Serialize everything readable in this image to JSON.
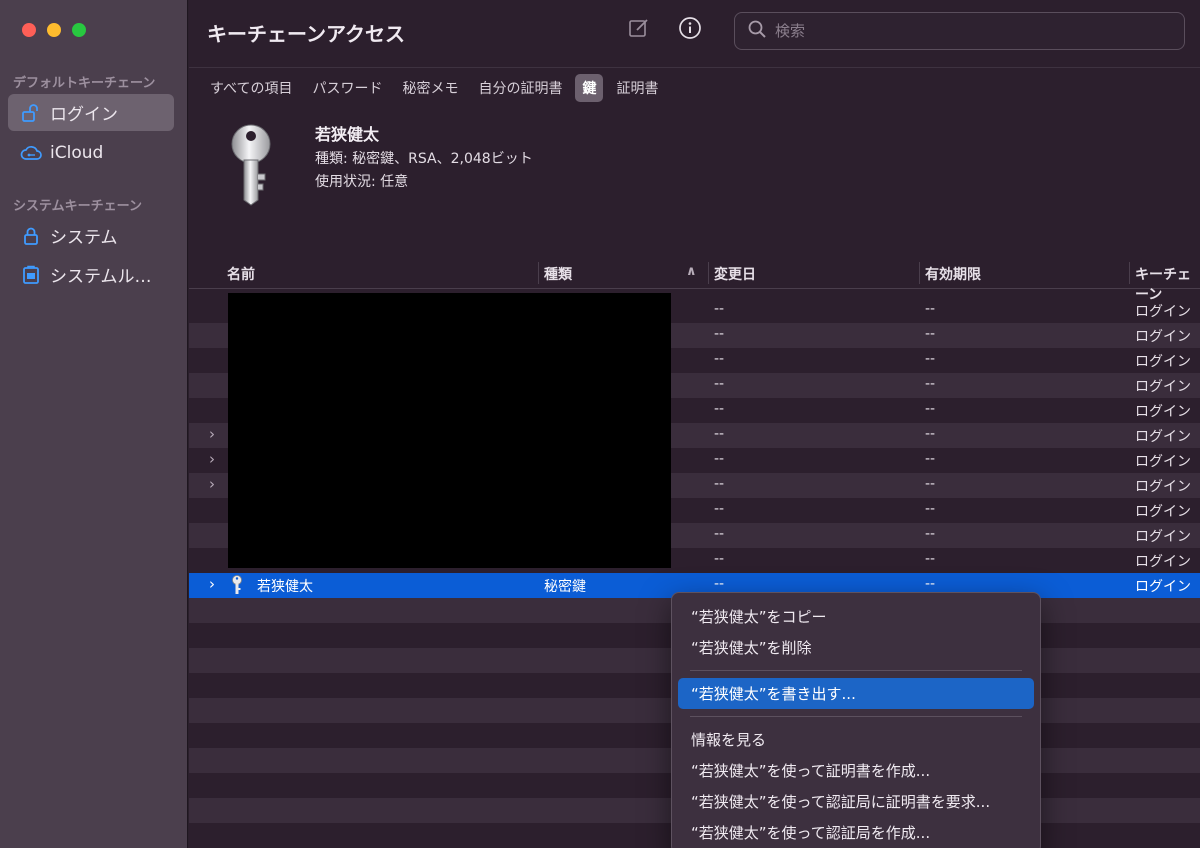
{
  "sidebar": {
    "default_section": "デフォルトキーチェーン",
    "system_section": "システムキーチェーン",
    "items": [
      {
        "label": "ログイン",
        "icon": "unlock-icon"
      },
      {
        "label": "iCloud",
        "icon": "cloud-icon"
      },
      {
        "label": "システム",
        "icon": "lock-icon"
      },
      {
        "label": "システムルート",
        "icon": "cabinet-icon"
      }
    ]
  },
  "toolbar": {
    "title": "キーチェーンアクセス",
    "search_placeholder": "検索"
  },
  "tabs": [
    "すべての項目",
    "パスワード",
    "秘密メモ",
    "自分の証明書",
    "鍵",
    "証明書"
  ],
  "active_tab": "鍵",
  "info": {
    "name": "若狭健太",
    "kind": "種類: 秘密鍵、RSA、2,048ビット",
    "usage": "使用状況: 任意"
  },
  "table": {
    "columns": [
      "名前",
      "種類",
      "変更日",
      "有効期限",
      "キーチェーン"
    ],
    "rows": [
      {
        "name": "",
        "kind": "",
        "modified": "--",
        "expires": "--",
        "keychain": "ログイン",
        "expandable": false
      },
      {
        "name": "",
        "kind": "",
        "modified": "--",
        "expires": "--",
        "keychain": "ログイン",
        "expandable": false
      },
      {
        "name": "",
        "kind": "",
        "modified": "--",
        "expires": "--",
        "keychain": "ログイン",
        "expandable": false
      },
      {
        "name": "",
        "kind": "",
        "modified": "--",
        "expires": "--",
        "keychain": "ログイン",
        "expandable": false
      },
      {
        "name": "",
        "kind": "",
        "modified": "--",
        "expires": "--",
        "keychain": "ログイン",
        "expandable": false
      },
      {
        "name": "",
        "kind": "",
        "modified": "--",
        "expires": "--",
        "keychain": "ログイン",
        "expandable": true
      },
      {
        "name": "",
        "kind": "",
        "modified": "--",
        "expires": "--",
        "keychain": "ログイン",
        "expandable": true
      },
      {
        "name": "",
        "kind": "",
        "modified": "--",
        "expires": "--",
        "keychain": "ログイン",
        "expandable": true
      },
      {
        "name": "",
        "kind": "",
        "modified": "--",
        "expires": "--",
        "keychain": "ログイン",
        "expandable": false
      },
      {
        "name": "",
        "kind": "",
        "modified": "--",
        "expires": "--",
        "keychain": "ログイン",
        "expandable": false
      },
      {
        "name": "",
        "kind": "",
        "modified": "--",
        "expires": "--",
        "keychain": "ログイン",
        "expandable": false
      },
      {
        "name": "若狭健太",
        "kind": "秘密鍵",
        "modified": "--",
        "expires": "--",
        "keychain": "ログイン",
        "expandable": true,
        "selected": true
      }
    ]
  },
  "context_menu": {
    "items": [
      "“若狭健太”をコピー",
      "“若狭健太”を削除",
      "“若狭健太”を書き出す...",
      "情報を見る",
      "“若狭健太”を使って証明書を作成...",
      "“若狭健太”を使って認証局に証明書を要求...",
      "“若狭健太”を使って認証局を作成..."
    ],
    "highlighted": "“若狭健太”を書き出す..."
  },
  "colors": {
    "selection": "#0b5dd6",
    "menu_highlight": "#1c65c6",
    "sidebar_bg": "#4b3f4d",
    "main_bg": "#2c1f2d"
  }
}
